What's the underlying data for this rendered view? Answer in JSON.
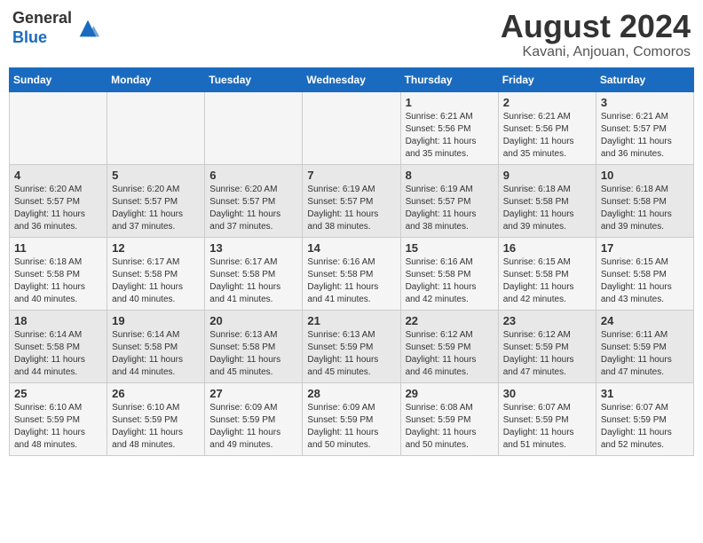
{
  "header": {
    "logo_general": "General",
    "logo_blue": "Blue",
    "month_year": "August 2024",
    "location": "Kavani, Anjouan, Comoros"
  },
  "days_of_week": [
    "Sunday",
    "Monday",
    "Tuesday",
    "Wednesday",
    "Thursday",
    "Friday",
    "Saturday"
  ],
  "weeks": [
    [
      {
        "day": "",
        "info": ""
      },
      {
        "day": "",
        "info": ""
      },
      {
        "day": "",
        "info": ""
      },
      {
        "day": "",
        "info": ""
      },
      {
        "day": "1",
        "info": "Sunrise: 6:21 AM\nSunset: 5:56 PM\nDaylight: 11 hours\nand 35 minutes."
      },
      {
        "day": "2",
        "info": "Sunrise: 6:21 AM\nSunset: 5:56 PM\nDaylight: 11 hours\nand 35 minutes."
      },
      {
        "day": "3",
        "info": "Sunrise: 6:21 AM\nSunset: 5:57 PM\nDaylight: 11 hours\nand 36 minutes."
      }
    ],
    [
      {
        "day": "4",
        "info": "Sunrise: 6:20 AM\nSunset: 5:57 PM\nDaylight: 11 hours\nand 36 minutes."
      },
      {
        "day": "5",
        "info": "Sunrise: 6:20 AM\nSunset: 5:57 PM\nDaylight: 11 hours\nand 37 minutes."
      },
      {
        "day": "6",
        "info": "Sunrise: 6:20 AM\nSunset: 5:57 PM\nDaylight: 11 hours\nand 37 minutes."
      },
      {
        "day": "7",
        "info": "Sunrise: 6:19 AM\nSunset: 5:57 PM\nDaylight: 11 hours\nand 38 minutes."
      },
      {
        "day": "8",
        "info": "Sunrise: 6:19 AM\nSunset: 5:57 PM\nDaylight: 11 hours\nand 38 minutes."
      },
      {
        "day": "9",
        "info": "Sunrise: 6:18 AM\nSunset: 5:58 PM\nDaylight: 11 hours\nand 39 minutes."
      },
      {
        "day": "10",
        "info": "Sunrise: 6:18 AM\nSunset: 5:58 PM\nDaylight: 11 hours\nand 39 minutes."
      }
    ],
    [
      {
        "day": "11",
        "info": "Sunrise: 6:18 AM\nSunset: 5:58 PM\nDaylight: 11 hours\nand 40 minutes."
      },
      {
        "day": "12",
        "info": "Sunrise: 6:17 AM\nSunset: 5:58 PM\nDaylight: 11 hours\nand 40 minutes."
      },
      {
        "day": "13",
        "info": "Sunrise: 6:17 AM\nSunset: 5:58 PM\nDaylight: 11 hours\nand 41 minutes."
      },
      {
        "day": "14",
        "info": "Sunrise: 6:16 AM\nSunset: 5:58 PM\nDaylight: 11 hours\nand 41 minutes."
      },
      {
        "day": "15",
        "info": "Sunrise: 6:16 AM\nSunset: 5:58 PM\nDaylight: 11 hours\nand 42 minutes."
      },
      {
        "day": "16",
        "info": "Sunrise: 6:15 AM\nSunset: 5:58 PM\nDaylight: 11 hours\nand 42 minutes."
      },
      {
        "day": "17",
        "info": "Sunrise: 6:15 AM\nSunset: 5:58 PM\nDaylight: 11 hours\nand 43 minutes."
      }
    ],
    [
      {
        "day": "18",
        "info": "Sunrise: 6:14 AM\nSunset: 5:58 PM\nDaylight: 11 hours\nand 44 minutes."
      },
      {
        "day": "19",
        "info": "Sunrise: 6:14 AM\nSunset: 5:58 PM\nDaylight: 11 hours\nand 44 minutes."
      },
      {
        "day": "20",
        "info": "Sunrise: 6:13 AM\nSunset: 5:58 PM\nDaylight: 11 hours\nand 45 minutes."
      },
      {
        "day": "21",
        "info": "Sunrise: 6:13 AM\nSunset: 5:59 PM\nDaylight: 11 hours\nand 45 minutes."
      },
      {
        "day": "22",
        "info": "Sunrise: 6:12 AM\nSunset: 5:59 PM\nDaylight: 11 hours\nand 46 minutes."
      },
      {
        "day": "23",
        "info": "Sunrise: 6:12 AM\nSunset: 5:59 PM\nDaylight: 11 hours\nand 47 minutes."
      },
      {
        "day": "24",
        "info": "Sunrise: 6:11 AM\nSunset: 5:59 PM\nDaylight: 11 hours\nand 47 minutes."
      }
    ],
    [
      {
        "day": "25",
        "info": "Sunrise: 6:10 AM\nSunset: 5:59 PM\nDaylight: 11 hours\nand 48 minutes."
      },
      {
        "day": "26",
        "info": "Sunrise: 6:10 AM\nSunset: 5:59 PM\nDaylight: 11 hours\nand 48 minutes."
      },
      {
        "day": "27",
        "info": "Sunrise: 6:09 AM\nSunset: 5:59 PM\nDaylight: 11 hours\nand 49 minutes."
      },
      {
        "day": "28",
        "info": "Sunrise: 6:09 AM\nSunset: 5:59 PM\nDaylight: 11 hours\nand 50 minutes."
      },
      {
        "day": "29",
        "info": "Sunrise: 6:08 AM\nSunset: 5:59 PM\nDaylight: 11 hours\nand 50 minutes."
      },
      {
        "day": "30",
        "info": "Sunrise: 6:07 AM\nSunset: 5:59 PM\nDaylight: 11 hours\nand 51 minutes."
      },
      {
        "day": "31",
        "info": "Sunrise: 6:07 AM\nSunset: 5:59 PM\nDaylight: 11 hours\nand 52 minutes."
      }
    ]
  ]
}
